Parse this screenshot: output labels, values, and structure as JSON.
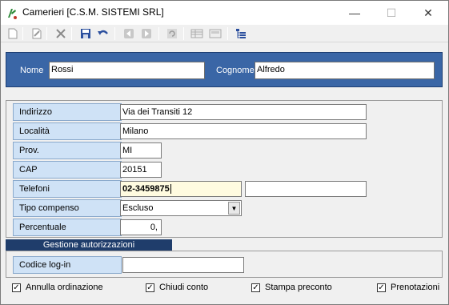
{
  "window": {
    "title": "Camerieri [C.S.M. SISTEMI SRL]",
    "minimize_glyph": "—",
    "maximize_glyph": "☐",
    "close_glyph": "✕"
  },
  "toolbar": {
    "buttons": [
      {
        "icon": "new-document-icon"
      },
      {
        "icon": "edit-icon"
      },
      {
        "icon": "delete-icon"
      },
      {
        "icon": "save-icon"
      },
      {
        "icon": "undo-icon"
      },
      {
        "icon": "previous-icon"
      },
      {
        "icon": "next-icon"
      },
      {
        "icon": "refresh-icon"
      },
      {
        "icon": "grid-view-icon"
      },
      {
        "icon": "form-view-icon"
      },
      {
        "icon": "tree-view-icon"
      }
    ]
  },
  "name_panel": {
    "nome_label": "Nome",
    "nome_value": "Rossi",
    "cognome_label": "Cognome",
    "cognome_value": "Alfredo"
  },
  "address": {
    "indirizzo_label": "Indirizzo",
    "indirizzo_value": "Via dei Transiti 12",
    "localita_label": "Località",
    "localita_value": "Milano",
    "prov_label": "Prov.",
    "prov_value": "MI",
    "cap_label": "CAP",
    "cap_value": "20151",
    "telefoni_label": "Telefoni",
    "telefono1_value": "02-3459875",
    "telefono2_value": "",
    "tipo_compenso_label": "Tipo compenso",
    "tipo_compenso_value": "Escluso",
    "percentuale_label": "Percentuale",
    "percentuale_value": "0,"
  },
  "auth": {
    "header": "Gestione autorizzazioni",
    "codice_label": "Codice log-in",
    "codice_value": ""
  },
  "permissions": [
    {
      "label": "Annulla ordinazione",
      "checked": true
    },
    {
      "label": "Chiudi conto",
      "checked": true
    },
    {
      "label": "Stampa preconto",
      "checked": true
    },
    {
      "label": "Prenotazioni",
      "checked": true
    }
  ],
  "colors": {
    "panel_blue": "#3a66a6",
    "label_blue": "#cfe2f6",
    "header_navy": "#1f3d6b",
    "active_field": "#fffbe0"
  }
}
